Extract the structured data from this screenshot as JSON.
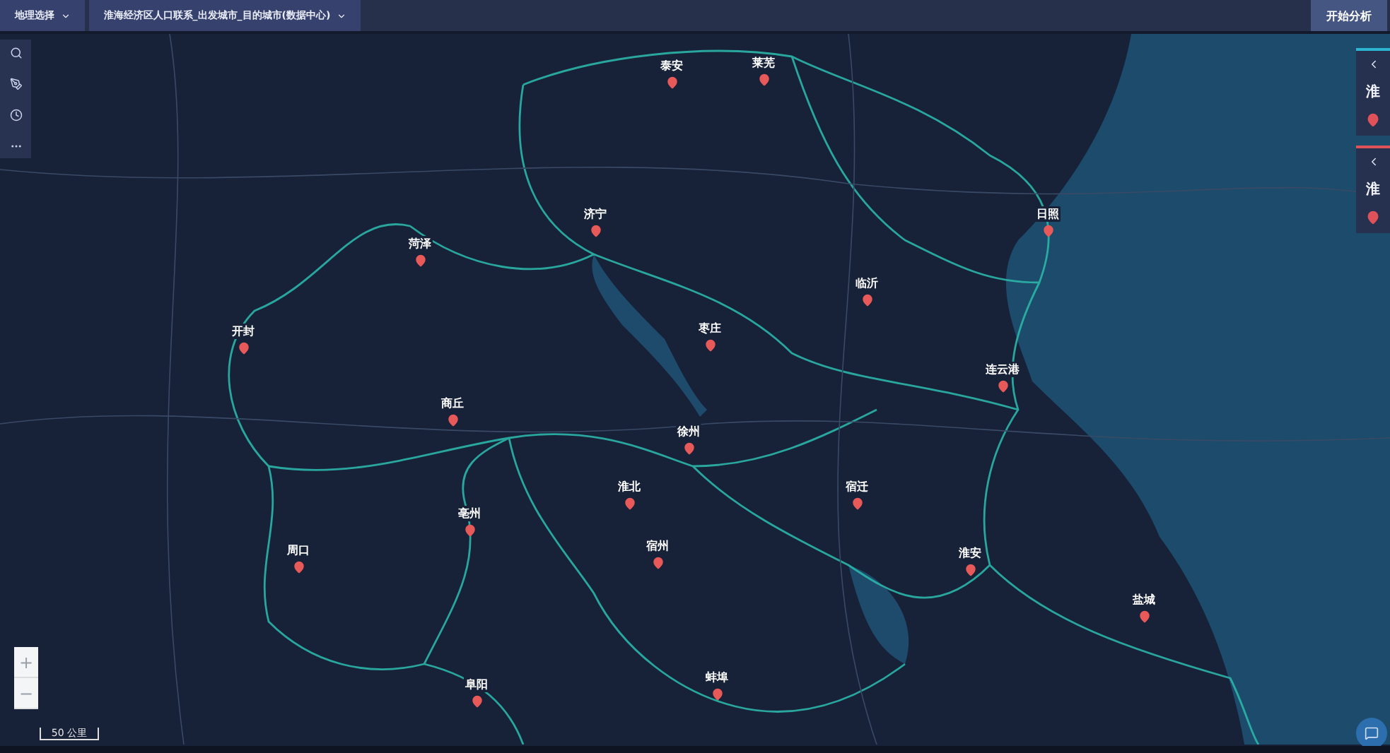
{
  "top_bar": {
    "geo_select": {
      "label": "地理选择"
    },
    "dataset_select": {
      "label": "淮海经济区人口联系_出发城市_目的城市(数据中心)"
    },
    "start_button": {
      "label": "开始分析"
    }
  },
  "right_panels": [
    {
      "label": "淮",
      "color": "#2bb5d0"
    },
    {
      "label": "淮",
      "color": "#e0525a"
    }
  ],
  "cities": [
    {
      "name": "泰安"
    },
    {
      "name": "莱芜"
    },
    {
      "name": "济宁"
    },
    {
      "name": "日照"
    },
    {
      "name": "菏泽"
    },
    {
      "name": "临沂"
    },
    {
      "name": "开封"
    },
    {
      "name": "枣庄"
    },
    {
      "name": "连云港"
    },
    {
      "name": "商丘"
    },
    {
      "name": "徐州"
    },
    {
      "name": "淮北"
    },
    {
      "name": "宿迁"
    },
    {
      "name": "亳州"
    },
    {
      "name": "周口"
    },
    {
      "name": "宿州"
    },
    {
      "name": "淮安"
    },
    {
      "name": "盐城"
    },
    {
      "name": "阜阳"
    },
    {
      "name": "蚌埠"
    }
  ],
  "zoom": {
    "plus": "+",
    "minus": "−"
  },
  "scale_bar": {
    "label": "50 公里"
  }
}
